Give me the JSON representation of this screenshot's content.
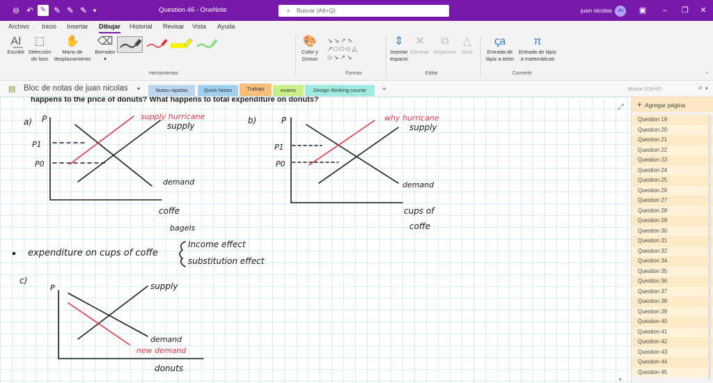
{
  "window": {
    "title": "Question 46  -  OneNote",
    "search_placeholder": "Buscar (Alt+Q)",
    "user_name": "juan nicolas",
    "user_initials": "JN"
  },
  "ribbon_tabs": [
    "Archivo",
    "Inicio",
    "Insertar",
    "Dibujar",
    "Historial",
    "Revisar",
    "Vista",
    "Ayuda"
  ],
  "active_tab": "Dibujar",
  "ribbon": {
    "write": "Escribir",
    "lasso_1": "Selección",
    "lasso_2": "de lazo",
    "pan_1": "Mano de",
    "pan_2": "desplazamiento",
    "eraser": "Borrador",
    "group_tools": "Herramientas",
    "color_1": "Color y",
    "color_2": "Grosor",
    "group_shapes": "Formas",
    "insert_space_1": "Insertar",
    "insert_space_2": "espacio",
    "delete": "Eliminar",
    "arrange": "Organizar",
    "rotate": "Girar",
    "group_edit": "Editar",
    "ink_text_1": "Entrada de",
    "ink_text_2": "lápiz a texto",
    "ink_math_1": "Entrada de lápiz",
    "ink_math_2": "a matemáticas",
    "group_convert": "Convertir",
    "pen_colors": [
      "#444444",
      "#e0323e",
      "#f5f500",
      "#8ce08c"
    ]
  },
  "notebook": {
    "name": "Bloc de notas de juan nicolas",
    "sections": [
      {
        "label": "Notas rápidas",
        "color": "#bcd6ef"
      },
      {
        "label": "Quick Notes",
        "color": "#9fd0f0"
      },
      {
        "label": "Trabajo",
        "color": "#f7bf7a"
      },
      {
        "label": "exams",
        "color": "#c9ef8b"
      },
      {
        "label": "Design thinking course",
        "color": "#9feae0"
      }
    ],
    "add_section": "+",
    "search_placeholder": "Buscar (Ctrl+E)"
  },
  "page": {
    "question_text": "happens to the price of donuts? What happens to total expenditure on donuts?"
  },
  "ink": {
    "a_label": "a)",
    "b_label": "b)",
    "c_label": "c)",
    "p": "P",
    "p1": "P1",
    "p0": "P0",
    "supply_hurricane_a": "supply hurricane",
    "supply_hurricane_b": "why hurricane",
    "supply": "supply",
    "demand": "demand",
    "new_demand": "new demand",
    "coffe": "coffe",
    "bagels": "bagels",
    "cups_of_1": "cups of",
    "cups_of_2": "coffe",
    "expenditure": "expenditure on cups of coffe",
    "income_effect": "Income effect",
    "substitution_effect": "substitution effect",
    "donuts": "donuts"
  },
  "pane": {
    "add_page": "Agregar página",
    "pages": [
      "Question 19",
      "Question 20",
      "Question 21",
      "Question 22",
      "Question 23",
      "Question 24",
      "Question 25",
      "Question 26",
      "Question 27",
      "Question 28",
      "Question 29",
      "Question 30",
      "Question 31",
      "Question 32",
      "Question 34",
      "Question 35",
      "Question 36",
      "Question 37",
      "Question 38",
      "Question 39",
      "Question 40",
      "Question 41",
      "Question 42",
      "Question 43",
      "Question 44",
      "Question 45"
    ]
  },
  "ink_colors": {
    "black": "#1a1a1a",
    "red": "#e0323e"
  }
}
